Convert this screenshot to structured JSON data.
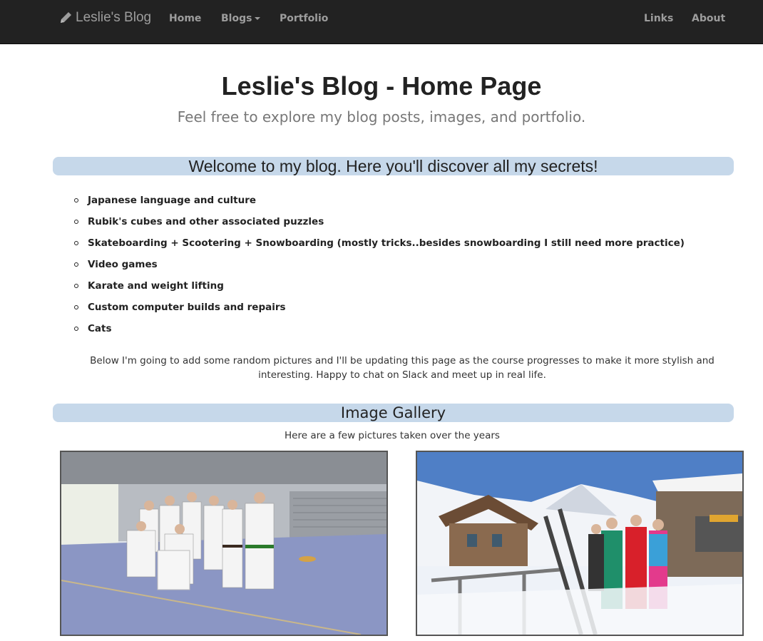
{
  "navbar": {
    "brand": "Leslie's Blog",
    "items": {
      "home": "Home",
      "blogs": "Blogs",
      "portfolio": "Portfolio",
      "links": "Links",
      "about": "About"
    }
  },
  "header": {
    "title": "Leslie's Blog - Home Page",
    "subtitle": "Feel free to explore my blog posts, images, and portfolio."
  },
  "welcome": {
    "heading": "Welcome to my blog. Here you'll discover all my secrets!",
    "interests": [
      "Japanese language and culture",
      "Rubik's cubes and other associated puzzles",
      "Skateboarding + Scootering + Snowboarding (mostly tricks..besides snowboarding I still need more practice)",
      "Video games",
      "Karate and weight lifting",
      "Custom computer builds and repairs",
      "Cats"
    ],
    "intro": "Below I'm going to add some random pictures and I'll be updating this page as the course progresses to make it more stylish and interesting. Happy to chat on Slack and meet up in real life."
  },
  "gallery": {
    "heading": "Image Gallery",
    "caption": "Here are a few pictures taken over the years"
  },
  "colors": {
    "navbar_bg": "#222222",
    "nav_text": "#9d9d9d",
    "section_bar": "#c6d8ea"
  },
  "icons": {
    "brand_icon": "pencil-icon",
    "dropdown_icon": "caret-down-icon"
  }
}
